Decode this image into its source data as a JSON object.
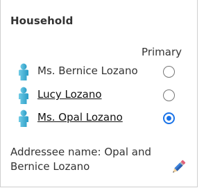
{
  "household": {
    "title": "Household",
    "primary_header": "Primary",
    "members": [
      {
        "name": "Ms. Bernice Lozano",
        "is_link": false,
        "primary": false,
        "icon": "person-icon"
      },
      {
        "name": "Lucy Lozano",
        "is_link": true,
        "primary": false,
        "icon": "person-icon"
      },
      {
        "name": "Ms. Opal Lozano",
        "is_link": true,
        "primary": true,
        "icon": "person-icon"
      }
    ],
    "addressee_text": "Addressee name: Opal and Bernice Lozano",
    "edit_icon": "pencil-icon"
  },
  "colors": {
    "person_icon": "#3ab0d6",
    "radio_selected": "#1a73e8"
  }
}
